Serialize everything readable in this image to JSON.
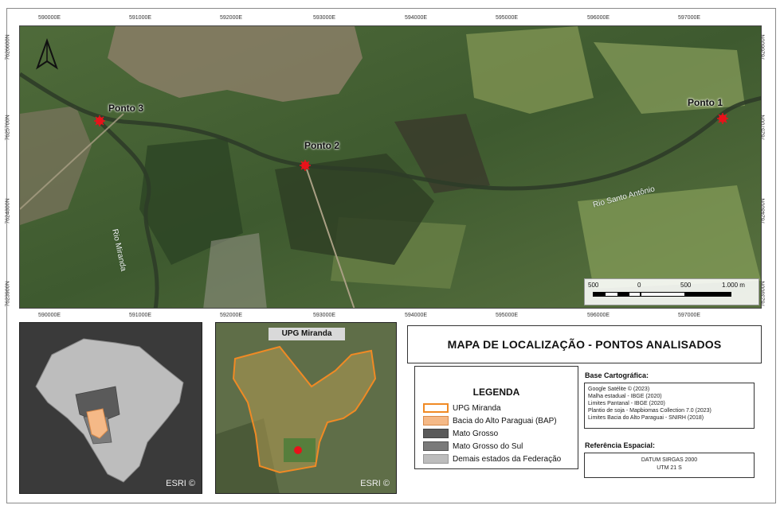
{
  "map": {
    "top_coords": [
      "590000E",
      "591000E",
      "592000E",
      "593000E",
      "594000E",
      "595000E",
      "596000E",
      "597000E"
    ],
    "bottom_coords": [
      "590000E",
      "591000E",
      "592000E",
      "593000E",
      "594000E",
      "595000E",
      "596000E",
      "597000E"
    ],
    "left_coords": [
      "7626600N",
      "7625700N",
      "7624800N",
      "7623900N"
    ],
    "right_coords": [
      "7626600N",
      "7625700N",
      "7624800N",
      "7623900N"
    ],
    "points": [
      {
        "label": "Ponto 1"
      },
      {
        "label": "Ponto 2"
      },
      {
        "label": "Ponto 3"
      }
    ],
    "rivers": [
      "Rio Miranda",
      "Rio Santo Antônio"
    ],
    "scale": {
      "labels": [
        "500",
        "0",
        "500",
        "1.000 m"
      ]
    },
    "north_icon": "north-arrow-icon"
  },
  "inset_brazil": {
    "credit": "ESRI ©"
  },
  "inset_upg": {
    "title": "UPG Miranda",
    "credit": "ESRI ©"
  },
  "panel": {
    "title": "MAPA DE LOCALIZAÇÃO - PONTOS ANALISADOS",
    "legend": {
      "title": "LEGENDA",
      "items": [
        {
          "label": "UPG Miranda",
          "fill": "#ffffff",
          "stroke": "#f08a24"
        },
        {
          "label": "Bacia do Alto Paraguai (BAP)",
          "fill": "#f5b987",
          "stroke": "#d98a4a"
        },
        {
          "label": "Mato Grosso",
          "fill": "#5a5a5a",
          "stroke": "#444444"
        },
        {
          "label": "Mato Grosso do Sul",
          "fill": "#7a7a7a",
          "stroke": "#555555"
        },
        {
          "label": "Demais estados da Federação",
          "fill": "#bdbdbd",
          "stroke": "#999999"
        }
      ]
    },
    "base_heading": "Base Cartográfica:",
    "base_lines": [
      "Google Satélite © (2023)",
      "Malha estadual - IBGE (2020)",
      "Limites Pantanal - IBGE (2020)",
      "Plantio de soja - Mapbiomas Collection 7.0 (2023)",
      "Limites Bacia do Alto Paraguai - SNIRH (2018)"
    ],
    "ref_heading": "Referência Espacial:",
    "ref_lines": [
      "DATUM SIRGAS 2000",
      "UTM 21 S"
    ]
  },
  "colors": {
    "point_marker": "#e8121a",
    "upg_outline": "#f08a24",
    "bap_fill": "#f5b987"
  }
}
